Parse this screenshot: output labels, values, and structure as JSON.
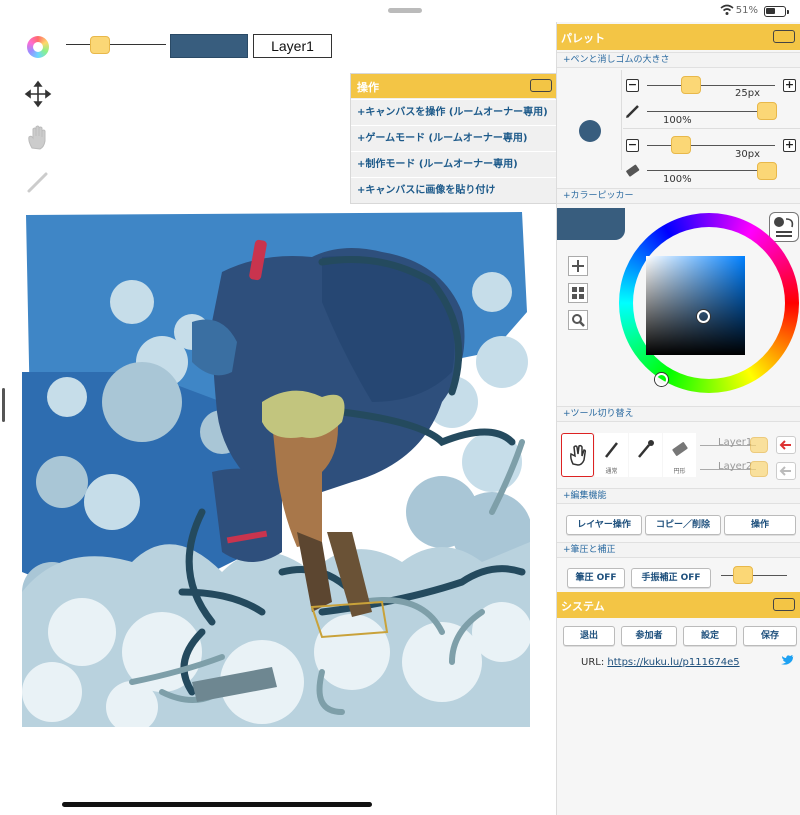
{
  "status_bar": {
    "battery_percent": "51%",
    "battery_level": 0.51
  },
  "toolbar": {
    "layer_name": "Layer1",
    "current_color": "#385d7e",
    "brush_size_level": 0.3
  },
  "operation_panel": {
    "title": "操作",
    "items": [
      "+キャンバスを操作 (ルームオーナー専用)",
      "+ゲームモード (ルームオーナー専用)",
      "+制作モード (ルームオーナー専用)",
      "+キャンバスに画像を貼り付け"
    ]
  },
  "palette": {
    "title": "パレット",
    "pen_size_header": "+ペンと消しゴムの大きさ",
    "pen_size": "25px",
    "pen_opacity": "100%",
    "eraser_size": "30px",
    "eraser_opacity": "100%",
    "color_picker_header": "+カラーピッカー",
    "tool_switch_header": "+ツール切り替え",
    "tool_labels": [
      "通常",
      "円形"
    ],
    "layers": [
      "Layer1",
      "Layer2"
    ],
    "edit_header": "+編集機能",
    "edit_buttons": [
      "レイヤー操作",
      "コピー／削除",
      "操作"
    ],
    "pressure_header": "+筆圧と補正",
    "pressure_buttons": [
      "筆圧 OFF",
      "手振補正 OFF"
    ]
  },
  "system": {
    "title": "システム",
    "buttons": [
      "退出",
      "参加者",
      "設定",
      "保存"
    ],
    "url_label": "URL:",
    "url": "https://kuku.lu/p111674e5"
  },
  "colors": {
    "accent": "#f3c545",
    "link": "#1d4f7c",
    "selected_color": "#385d7e"
  }
}
